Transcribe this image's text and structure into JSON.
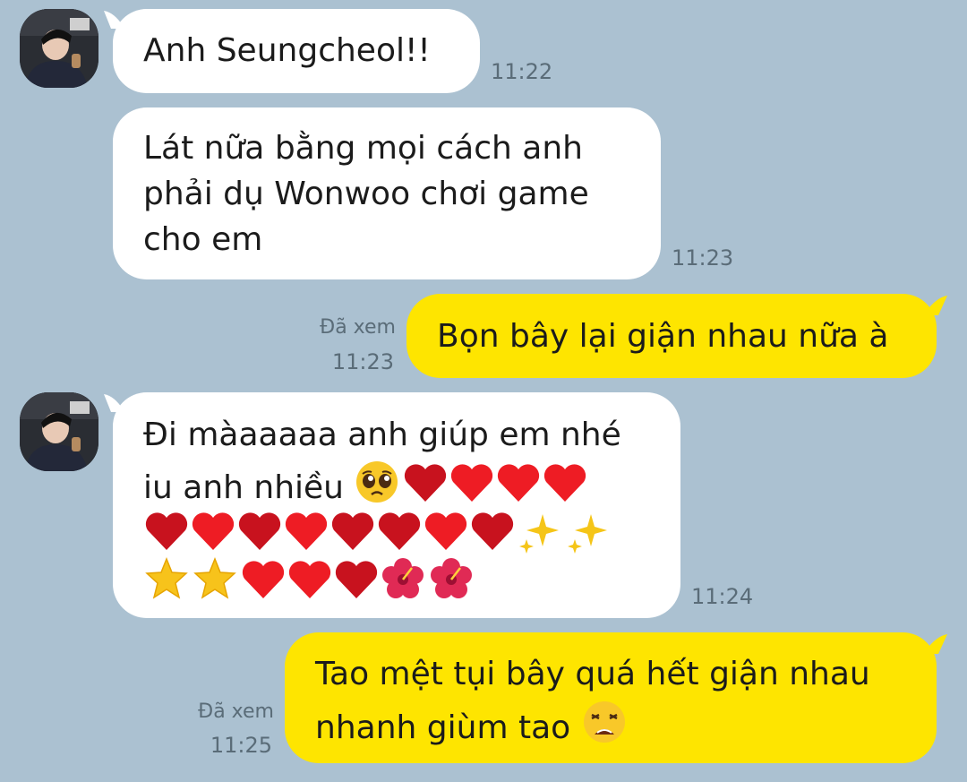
{
  "chat": {
    "messages": [
      {
        "direction": "incoming",
        "lines": [
          "Anh Seungcheol!!"
        ],
        "time": "11:22"
      },
      {
        "direction": "incoming",
        "lines": [
          "Lát nữa bằng mọi cách anh",
          "phải dụ Wonwoo chơi game",
          "cho em"
        ],
        "time": "11:23"
      },
      {
        "direction": "outgoing",
        "lines": [
          "Bọn bây lại giận nhau nữa à"
        ],
        "read_label": "Đã xem",
        "time": "11:23"
      },
      {
        "direction": "incoming",
        "lines": [
          "Đi màaaaaa anh giúp em nhé",
          "iu anh nhiều"
        ],
        "time": "11:24",
        "emoji": [
          "pleading-face",
          "red-heart",
          "red-heart",
          "red-heart",
          "red-heart",
          "red-heart",
          "red-heart",
          "red-heart",
          "red-heart",
          "red-heart",
          "red-heart",
          "red-heart",
          "red-heart",
          "sparkles",
          "sparkles",
          "star",
          "star",
          "red-heart",
          "red-heart",
          "red-heart",
          "hibiscus",
          "hibiscus"
        ]
      },
      {
        "direction": "outgoing",
        "lines": [
          "Tao mệt tụi bây quá hết giận nhau",
          "nhanh giùm tao"
        ],
        "read_label": "Đã xem",
        "time": "11:25",
        "emoji": [
          "weary-face"
        ]
      }
    ]
  },
  "colors": {
    "background": "#abc1d1",
    "incoming_bubble": "#ffffff",
    "outgoing_bubble": "#fee500",
    "heart_dark": "#c8121e",
    "heart_light": "#ee1c24"
  }
}
